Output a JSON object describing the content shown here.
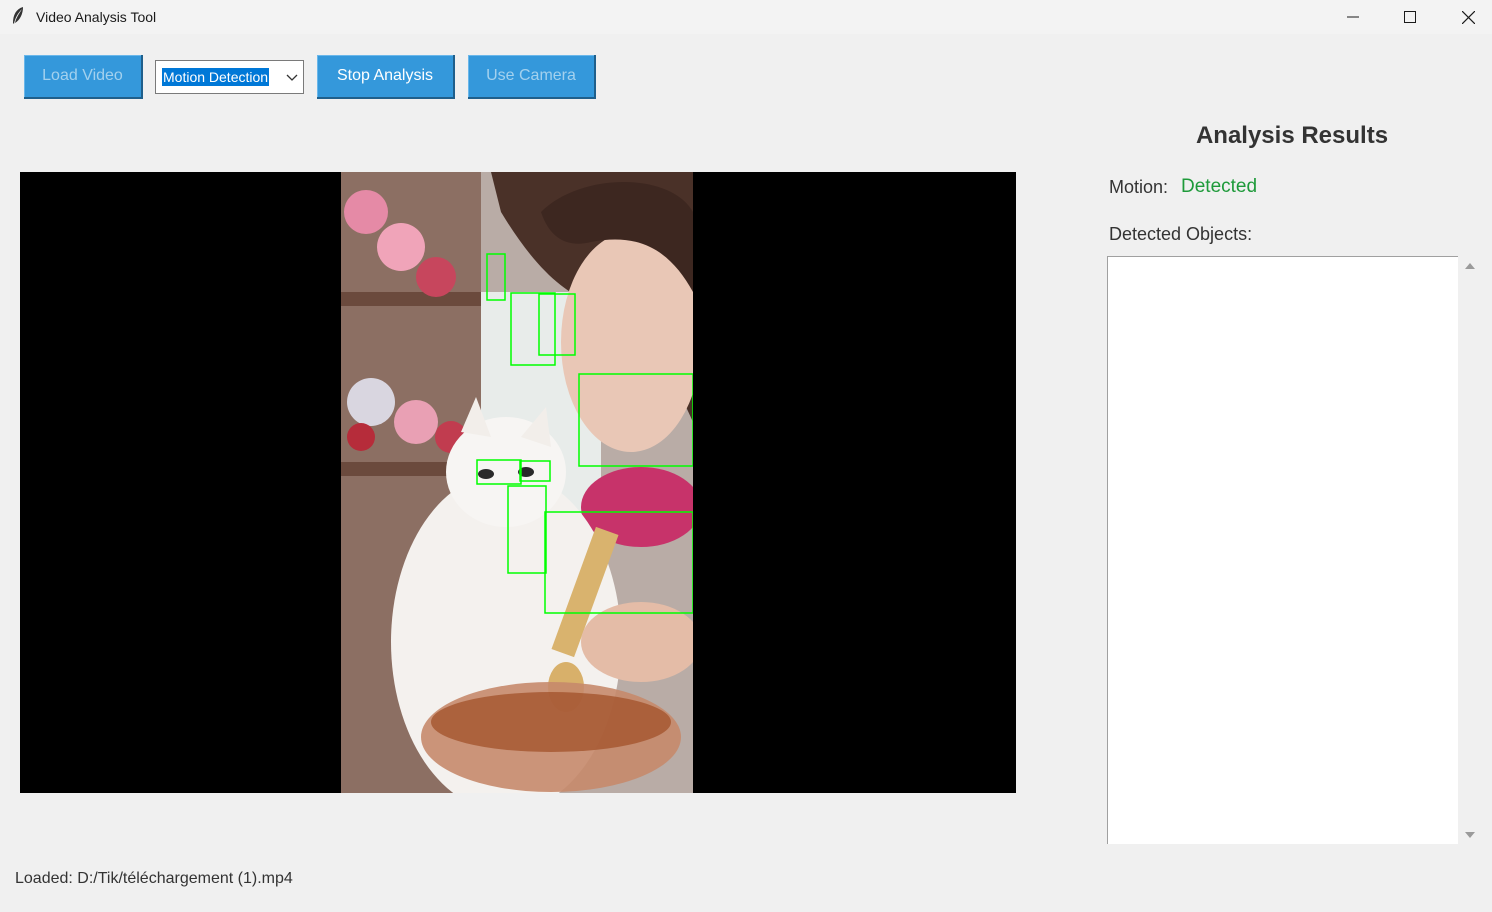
{
  "window": {
    "title": "Video Analysis Tool"
  },
  "toolbar": {
    "load_video_label": "Load Video",
    "mode_select_value": "Motion Detection",
    "stop_analysis_label": "Stop Analysis",
    "use_camera_label": "Use Camera"
  },
  "results": {
    "title": "Analysis Results",
    "motion_label": "Motion:",
    "motion_value": "Detected",
    "objects_label": "Detected Objects:",
    "objects": []
  },
  "status": {
    "text": "Loaded: D:/Tik/téléchargement (1).mp4"
  },
  "colors": {
    "button_bg": "#3498db",
    "motion_detected": "#1e9a3a",
    "bounding_box": "#00ff00"
  },
  "icons": {
    "app": "feather-icon",
    "minimize": "minimize-icon",
    "maximize": "maximize-icon",
    "close": "close-icon"
  }
}
